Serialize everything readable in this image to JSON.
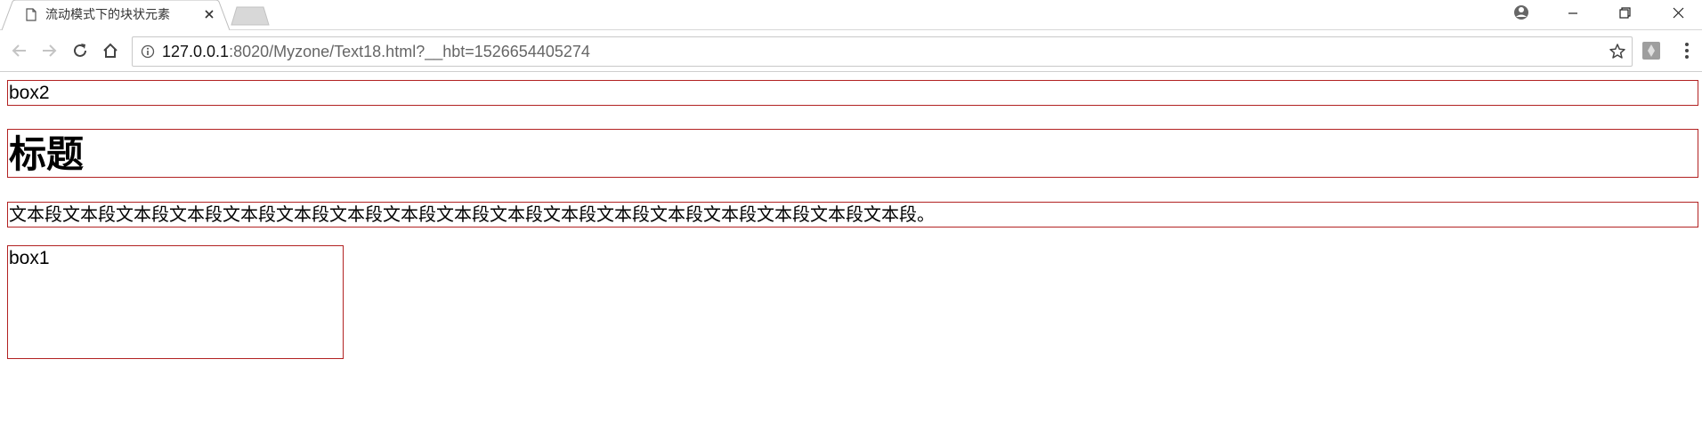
{
  "browser": {
    "tab": {
      "title": "流动模式下的块状元素",
      "page_icon": "page-icon",
      "close_icon": "close-icon"
    },
    "new_tab_icon": "new-tab-icon",
    "window_controls": [
      "account-icon",
      "minimize-icon",
      "restore-icon",
      "close-window-icon"
    ],
    "nav": {
      "back_icon": "back-arrow-icon",
      "forward_icon": "forward-arrow-icon",
      "reload_icon": "reload-icon",
      "home_icon": "home-icon"
    },
    "address_bar": {
      "host": "127.0.0.1",
      "path": ":8020/Myzone/Text18.html?__hbt=1526654405274",
      "info_icon": "info-icon",
      "bookmark_icon": "star-icon"
    },
    "extension_icon": "extension-icon",
    "menu_icon": "menu-dots-icon"
  },
  "page": {
    "box2": "box2",
    "heading": "标题",
    "paragraph": "文本段文本段文本段文本段文本段文本段文本段文本段文本段文本段文本段文本段文本段文本段文本段文本段文本段。",
    "box1": "box1"
  },
  "colors": {
    "box_border": "#b22222"
  }
}
